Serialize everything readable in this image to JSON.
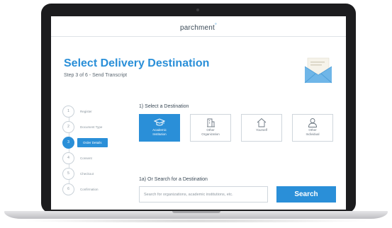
{
  "header": {
    "logo_text": "parchment",
    "logo_mark": "°"
  },
  "page": {
    "title": "Select Delivery Destination",
    "subtitle": "Step 3 of 6 - Send Transcript",
    "illustration_icon": "envelope-icon"
  },
  "steps": [
    {
      "number": "1",
      "label": "Register",
      "active": false
    },
    {
      "number": "2",
      "label": "Document Type",
      "active": false
    },
    {
      "number": "3",
      "label": "Order Details",
      "active": true
    },
    {
      "number": "4",
      "label": "Consent",
      "active": false
    },
    {
      "number": "5",
      "label": "Checkout",
      "active": false
    },
    {
      "number": "6",
      "label": "Confirmation",
      "active": false
    }
  ],
  "destination": {
    "section_label": "1) Select a Destination",
    "options": [
      {
        "label_line1": "Academic",
        "label_line2": "Institution",
        "icon": "graduation-cap-icon",
        "selected": true
      },
      {
        "label_line1": "Other",
        "label_line2": "Organization",
        "icon": "building-icon",
        "selected": false
      },
      {
        "label_line1": "Yourself",
        "label_line2": "",
        "icon": "home-icon",
        "selected": false
      },
      {
        "label_line1": "Other",
        "label_line2": "Individual",
        "icon": "person-icon",
        "selected": false
      }
    ]
  },
  "search": {
    "section_label": "1a) Or Search for a Destination",
    "placeholder": "Search for organizations, academic institutions, etc.",
    "button_label": "Search"
  },
  "colors": {
    "accent": "#2a8fd8",
    "text_dark": "#3b4a57",
    "text_muted": "#8a959e",
    "border": "#cfd6dc",
    "laptop_frame": "#1c1c1e"
  }
}
